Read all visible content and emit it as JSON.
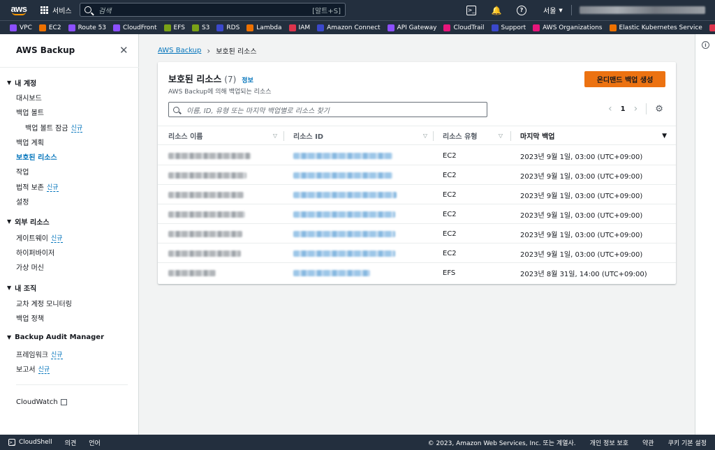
{
  "topnav": {
    "logo_text": "aws",
    "services_label": "서비스",
    "search_placeholder": "검색",
    "search_shortcut": "[알트+S]",
    "terminal_glyph": ">_",
    "bell_glyph": "🔔",
    "help_glyph": "?",
    "region_label": "서울",
    "region_caret": "▼"
  },
  "favorites": [
    {
      "label": "VPC",
      "color": "#8c4fff"
    },
    {
      "label": "EC2",
      "color": "#ed7100"
    },
    {
      "label": "Route 53",
      "color": "#8c4fff"
    },
    {
      "label": "CloudFront",
      "color": "#8c4fff"
    },
    {
      "label": "EFS",
      "color": "#7aa116"
    },
    {
      "label": "S3",
      "color": "#7aa116"
    },
    {
      "label": "RDS",
      "color": "#3b48cc"
    },
    {
      "label": "Lambda",
      "color": "#ed7100"
    },
    {
      "label": "IAM",
      "color": "#dd344c"
    },
    {
      "label": "Amazon Connect",
      "color": "#3b48cc"
    },
    {
      "label": "API Gateway",
      "color": "#8c4fff"
    },
    {
      "label": "CloudTrail",
      "color": "#e7157b"
    },
    {
      "label": "Support",
      "color": "#3b48cc"
    },
    {
      "label": "AWS Organizations",
      "color": "#e7157b"
    },
    {
      "label": "Elastic Kubernetes Service",
      "color": "#ed7100"
    },
    {
      "label": "Ce",
      "color": "#dd344c"
    }
  ],
  "sidenav": {
    "title": "AWS Backup",
    "close_glyph": "✕",
    "section_caret": "▼",
    "sections": [
      {
        "label": "내 계정"
      },
      {
        "label": "외부 리소스"
      },
      {
        "label": "내 조직"
      },
      {
        "label": "Backup Audit Manager"
      }
    ],
    "items": [
      {
        "label": "대시보드"
      },
      {
        "label": "백업 볼트"
      },
      {
        "label": "백업 볼트 잠금",
        "badge": "신규"
      },
      {
        "label": "백업 계획"
      },
      {
        "label": "보호된 리소스"
      },
      {
        "label": "작업"
      },
      {
        "label": "법적 보존",
        "badge": "신규"
      },
      {
        "label": "설정"
      },
      {
        "label": "게이트웨이",
        "badge": "신규"
      },
      {
        "label": "하이퍼바이저"
      },
      {
        "label": "가상 머신"
      },
      {
        "label": "교차 계정 모니터링"
      },
      {
        "label": "백업 정책"
      },
      {
        "label": "프레임워크",
        "badge": "신규"
      },
      {
        "label": "보고서",
        "badge": "신규"
      },
      {
        "label": "CloudWatch"
      }
    ]
  },
  "breadcrumb": {
    "root": "AWS Backup",
    "separator": "›",
    "current": "보호된 리소스"
  },
  "panel": {
    "title": "보호된 리소스",
    "count": "(7)",
    "info_link": "정보",
    "description": "AWS Backup에 의해 백업되는 리소스",
    "primary_button": "온디맨드 백업 생성",
    "filter_placeholder": "이름, ID, 유형 또는 마지막 백업별로 리소스 찾기",
    "pager": {
      "prev_glyph": "‹",
      "page": "1",
      "next_glyph": "›"
    },
    "settings_glyph": "⚙",
    "columns": [
      {
        "label": "리소스 이름",
        "sort_glyph": "▽"
      },
      {
        "label": "리소스 ID",
        "sort_glyph": "▽"
      },
      {
        "label": "리소스 유형",
        "sort_glyph": "▽"
      },
      {
        "label": "마지막 백업",
        "sort_glyph": "▼"
      }
    ],
    "rows": [
      {
        "type": "EC2",
        "last_backup": "2023년 9월 1일, 03:00 (UTC+09:00)"
      },
      {
        "type": "EC2",
        "last_backup": "2023년 9월 1일, 03:00 (UTC+09:00)"
      },
      {
        "type": "EC2",
        "last_backup": "2023년 9월 1일, 03:00 (UTC+09:00)"
      },
      {
        "type": "EC2",
        "last_backup": "2023년 9월 1일, 03:00 (UTC+09:00)"
      },
      {
        "type": "EC2",
        "last_backup": "2023년 9월 1일, 03:00 (UTC+09:00)"
      },
      {
        "type": "EC2",
        "last_backup": "2023년 9월 1일, 03:00 (UTC+09:00)"
      },
      {
        "type": "EFS",
        "last_backup": "2023년 8월 31일, 14:00 (UTC+09:00)"
      }
    ]
  },
  "footer": {
    "cloudshell": "CloudShell",
    "cloudshell_glyph": ">_",
    "feedback": "의견",
    "language": "언어",
    "copyright": "© 2023, Amazon Web Services, Inc. 또는 계열사.",
    "privacy": "개인 정보 보호",
    "terms": "약관",
    "cookies": "쿠키 기본 설정"
  },
  "rightstrip": {
    "info_glyph": "i"
  }
}
